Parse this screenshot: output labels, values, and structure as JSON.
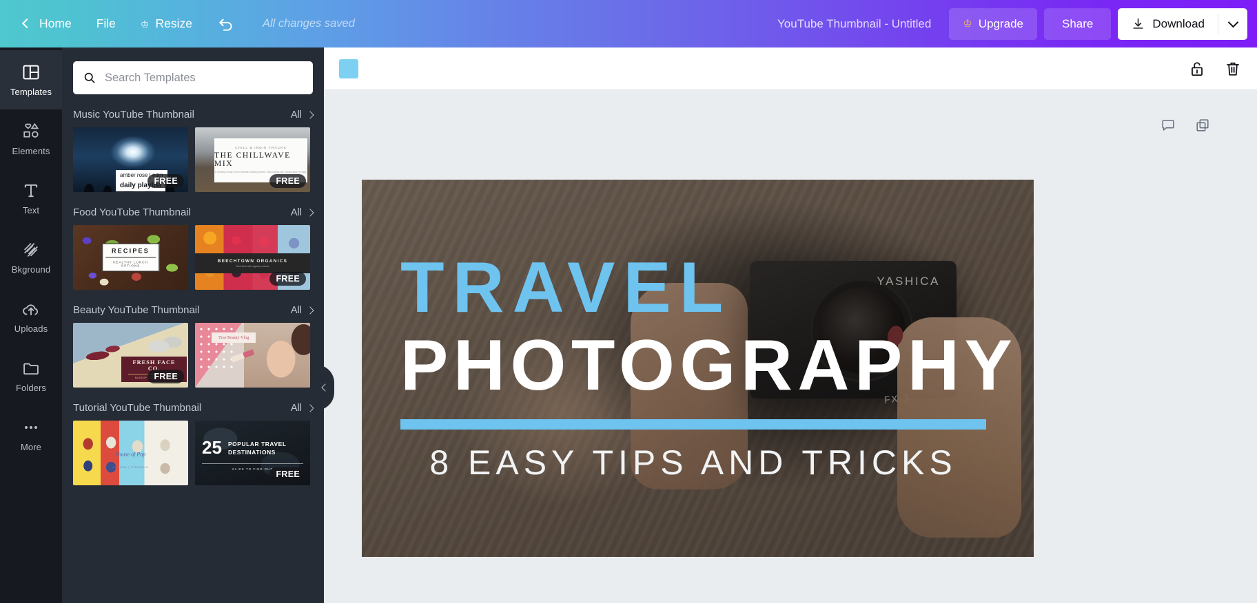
{
  "header": {
    "home_label": "Home",
    "file_label": "File",
    "resize_label": "Resize",
    "resize_icon": "crown-icon",
    "undo_icon": "undo-arrow-icon",
    "save_status": "All changes saved",
    "doc_title": "YouTube Thumbnail - Untitled",
    "upgrade_label": "Upgrade",
    "upgrade_icon": "crown-icon",
    "share_label": "Share",
    "download_label": "Download",
    "download_icon": "download-arrow-icon",
    "download_caret_icon": "chevron-down-icon",
    "gradient_start": "#4fc8ce",
    "gradient_end": "#7d1ef7"
  },
  "sidebar": {
    "items": [
      {
        "label": "Templates",
        "icon": "layout-grid-icon",
        "active": true
      },
      {
        "label": "Elements",
        "icon": "shapes-icon",
        "active": false
      },
      {
        "label": "Text",
        "icon": "text-t-icon",
        "active": false
      },
      {
        "label": "Bkground",
        "icon": "hatch-pattern-icon",
        "active": false
      },
      {
        "label": "Uploads",
        "icon": "cloud-upload-icon",
        "active": false
      },
      {
        "label": "Folders",
        "icon": "folder-icon",
        "active": false
      },
      {
        "label": "More",
        "icon": "ellipsis-icon",
        "active": false
      }
    ]
  },
  "panel": {
    "search": {
      "placeholder": "Search Templates",
      "value": "",
      "icon": "search-icon"
    },
    "all_label": "All",
    "sections": [
      {
        "title": "Music YouTube Thumbnail",
        "thumbs": [
          {
            "art": "t-music1",
            "free": "FREE",
            "label_a": "amber rose | edm",
            "label_b": "daily playlist"
          },
          {
            "art": "t-music2",
            "free": "FREE",
            "kicker": "CHILL & INDIE TRACKS",
            "title": "THE CHILLWAVE MIX",
            "sub": "A monthly recap of our favorite soothing tunes. New videos are posted every Friday."
          }
        ]
      },
      {
        "title": "Food YouTube Thumbnail",
        "thumbs": [
          {
            "art": "t-food1",
            "free": "",
            "title": "RECIPES",
            "sub": "HEALTHY LUNCH OPTIONS"
          },
          {
            "art": "t-food2",
            "free": "FREE",
            "title": "BEECHTOWN ORGANICS",
            "sub": "Real fresh with organic produce"
          }
        ]
      },
      {
        "title": "Beauty YouTube Thumbnail",
        "thumbs": [
          {
            "art": "t-beauty1",
            "free": "FREE",
            "title": "FRESH FACE CO.",
            "sub": "MAKEUP TUTORIAL & TIPS"
          },
          {
            "art": "t-beauty2",
            "free": "",
            "title": "True Beauty Vlog"
          }
        ]
      },
      {
        "title": "Tutorial YouTube Thumbnail",
        "thumbs": [
          {
            "art": "t-tut1",
            "free": "",
            "title": "House of Pop",
            "sub": "FASHION | TUTORIALS"
          },
          {
            "art": "t-tut2",
            "free": "FREE",
            "num": "25",
            "line1": "POPULAR TRAVEL",
            "line2": "DESTINATIONS",
            "cta": "CLICK TO FIND OUT"
          }
        ]
      }
    ],
    "collapse_icon": "chevron-left-icon"
  },
  "editor": {
    "toolbar": {
      "color_swatch": "#7ed0f2",
      "lock_icon": "unlock-icon",
      "trash_icon": "trash-icon"
    },
    "page_tools": {
      "comment_icon": "comment-icon",
      "duplicate_icon": "copy-icon"
    },
    "design": {
      "title_line1": "TRAVEL",
      "title_line2": "PHOTOGRAPHY",
      "subtitle": "8 EASY TIPS AND TRICKS",
      "accent_color": "#6ec3ef",
      "camera_brand": "YASHICA",
      "camera_model": "FX-3"
    }
  }
}
